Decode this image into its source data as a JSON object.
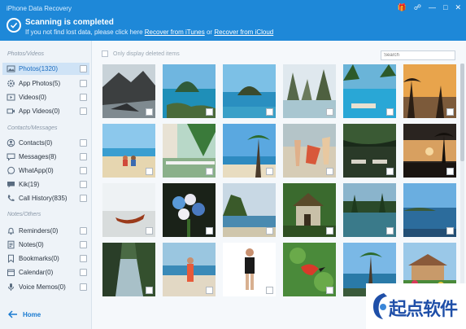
{
  "window": {
    "title": "iPhone Data Recovery",
    "controls": [
      "gift-icon",
      "pin-icon",
      "minimize-icon",
      "maximize-icon",
      "close-icon"
    ]
  },
  "status": {
    "title": "Scanning is completed",
    "message_prefix": "If you not find lost data, please click here",
    "link_itunes": "Recover from iTunes",
    "message_or": "or",
    "link_icloud": "Recover from iCloud"
  },
  "sidebar": {
    "sections": [
      {
        "header": "Photos/Videos",
        "items": [
          {
            "label": "Photos(1320)",
            "icon": "photo-icon",
            "active": true
          },
          {
            "label": "App Photos(5)",
            "icon": "gear-icon",
            "active": false
          },
          {
            "label": "Videos(0)",
            "icon": "video-icon",
            "active": false
          },
          {
            "label": "App Videos(0)",
            "icon": "camera-icon",
            "active": false
          }
        ]
      },
      {
        "header": "Contacts/Messages",
        "items": [
          {
            "label": "Contacts(0)",
            "icon": "contact-icon",
            "active": false
          },
          {
            "label": "Messages(8)",
            "icon": "message-icon",
            "active": false
          },
          {
            "label": "WhatApp(0)",
            "icon": "whatsapp-icon",
            "active": false
          },
          {
            "label": "Kik(19)",
            "icon": "kik-icon",
            "active": false
          },
          {
            "label": "Call History(835)",
            "icon": "phone-icon",
            "active": false
          }
        ]
      },
      {
        "header": "Notes/Others",
        "items": [
          {
            "label": "Reminders(0)",
            "icon": "bell-icon",
            "active": false
          },
          {
            "label": "Notes(0)",
            "icon": "note-icon",
            "active": false
          },
          {
            "label": "Bookmarks(0)",
            "icon": "bookmark-icon",
            "active": false
          },
          {
            "label": "Calendar(0)",
            "icon": "calendar-icon",
            "active": false
          },
          {
            "label": "Voice Memos(0)",
            "icon": "microphone-icon",
            "active": false
          }
        ]
      }
    ],
    "home_label": "Home"
  },
  "main": {
    "filter_label": "Only display deleted items",
    "search_placeholder": "Search",
    "photos": [
      {
        "scene": "rocky-shore"
      },
      {
        "scene": "tropical-island"
      },
      {
        "scene": "rock-island"
      },
      {
        "scene": "limestone-cliffs"
      },
      {
        "scene": "beach-resort-pool"
      },
      {
        "scene": "sunset-palms"
      },
      {
        "scene": "beach-couple"
      },
      {
        "scene": "beach-balcony"
      },
      {
        "scene": "palm-beach"
      },
      {
        "scene": "drinks-on-beach"
      },
      {
        "scene": "beach-loungers"
      },
      {
        "scene": "sunset-silhouette"
      },
      {
        "scene": "beach-boat"
      },
      {
        "scene": "flower-bouquet"
      },
      {
        "scene": "island-coast"
      },
      {
        "scene": "jungle-hut"
      },
      {
        "scene": "lagoon-reflection"
      },
      {
        "scene": "calm-bay"
      },
      {
        "scene": "river-canyon"
      },
      {
        "scene": "beach-woman"
      },
      {
        "scene": "standing-woman"
      },
      {
        "scene": "red-bird"
      },
      {
        "scene": "palm-shore"
      },
      {
        "scene": "garden-house"
      }
    ]
  },
  "watermark": {
    "text": "起点软件"
  },
  "colors": {
    "accent": "#1e88d8",
    "sidebar_bg": "#eef3f8",
    "active_item": "#cfe3f6",
    "link": "#1a7ad0"
  }
}
